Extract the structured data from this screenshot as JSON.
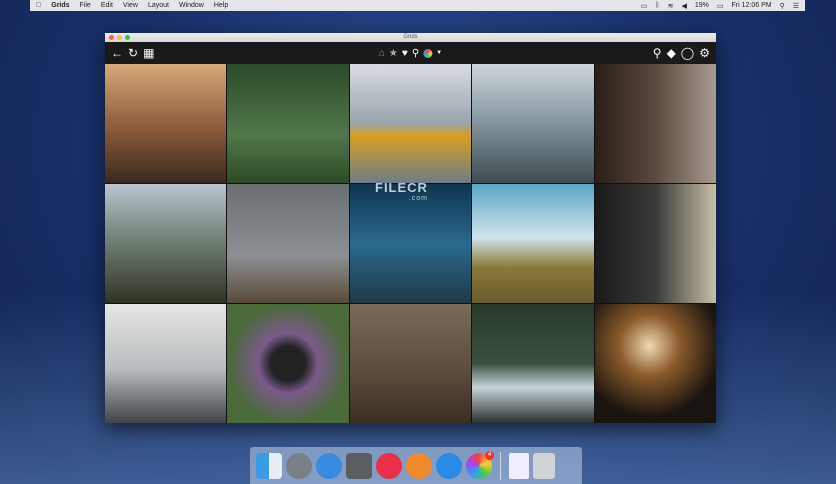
{
  "menubar": {
    "items": [
      "Grids",
      "File",
      "Edit",
      "View",
      "Layout",
      "Window",
      "Help"
    ],
    "battery": "19%",
    "clock": "Fri 12:06 PM"
  },
  "window": {
    "title": "Grids"
  },
  "toolbar": {
    "left": [
      "back-arrow-icon",
      "refresh-icon",
      "grid-icon"
    ],
    "center": [
      "home-icon",
      "star-icon",
      "heart-icon",
      "location-pin-icon",
      "account-avatar"
    ],
    "right": [
      "search-icon",
      "tag-icon",
      "chat-icon",
      "gear-icon"
    ]
  },
  "photos": [
    "sunset coast",
    "forest bride",
    "yellow hood lake",
    "couple sea cliff",
    "window light portrait",
    "river valley",
    "stormy field",
    "pier meditation",
    "wheat field",
    "shadow portrait",
    "rowing boat",
    "flowers camera",
    "grass hat person",
    "waterfall forest",
    "bicycle sunset"
  ],
  "watermark": {
    "name": "FILECR",
    "tld": ".com"
  },
  "dock": {
    "apps": [
      "Finder",
      "Launchpad",
      "Safari",
      "System Preferences",
      "iTunes",
      "iBooks",
      "App Store",
      "Grids",
      "Documents",
      "Trash"
    ],
    "grids_badge": "4"
  }
}
